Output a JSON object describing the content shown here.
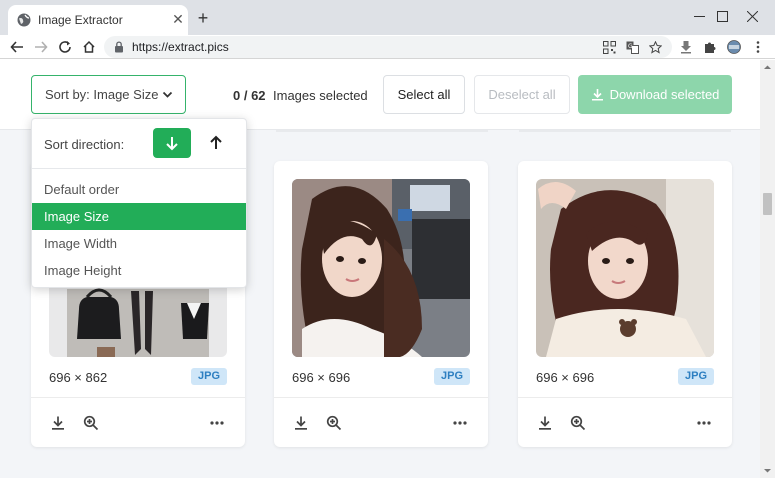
{
  "browser": {
    "tab_title": "Image Extractor",
    "url": "https://extract.pics"
  },
  "header": {
    "sort_label": "Sort by: Image Size",
    "selected_count": "0 / 62",
    "selected_text": "Images selected",
    "select_all": "Select all",
    "deselect_all": "Deselect all",
    "download_selected": "Download selected"
  },
  "sort_menu": {
    "direction_label": "Sort direction:",
    "direction": "descending",
    "options": [
      {
        "label": "Default order",
        "active": false
      },
      {
        "label": "Image Size",
        "active": true
      },
      {
        "label": "Image Width",
        "active": false
      },
      {
        "label": "Image Height",
        "active": false
      }
    ]
  },
  "cards": [
    {
      "dims": "696 × 862",
      "format": "JPG"
    },
    {
      "dims": "696 × 696",
      "format": "JPG"
    },
    {
      "dims": "696 × 696",
      "format": "JPG"
    }
  ],
  "colors": {
    "accent": "#22ad58",
    "download_disabled": "#8dd6ab",
    "badge_bg": "#cfe6f8",
    "badge_text": "#2d7fc1",
    "page_bg": "#f3f5f8"
  }
}
